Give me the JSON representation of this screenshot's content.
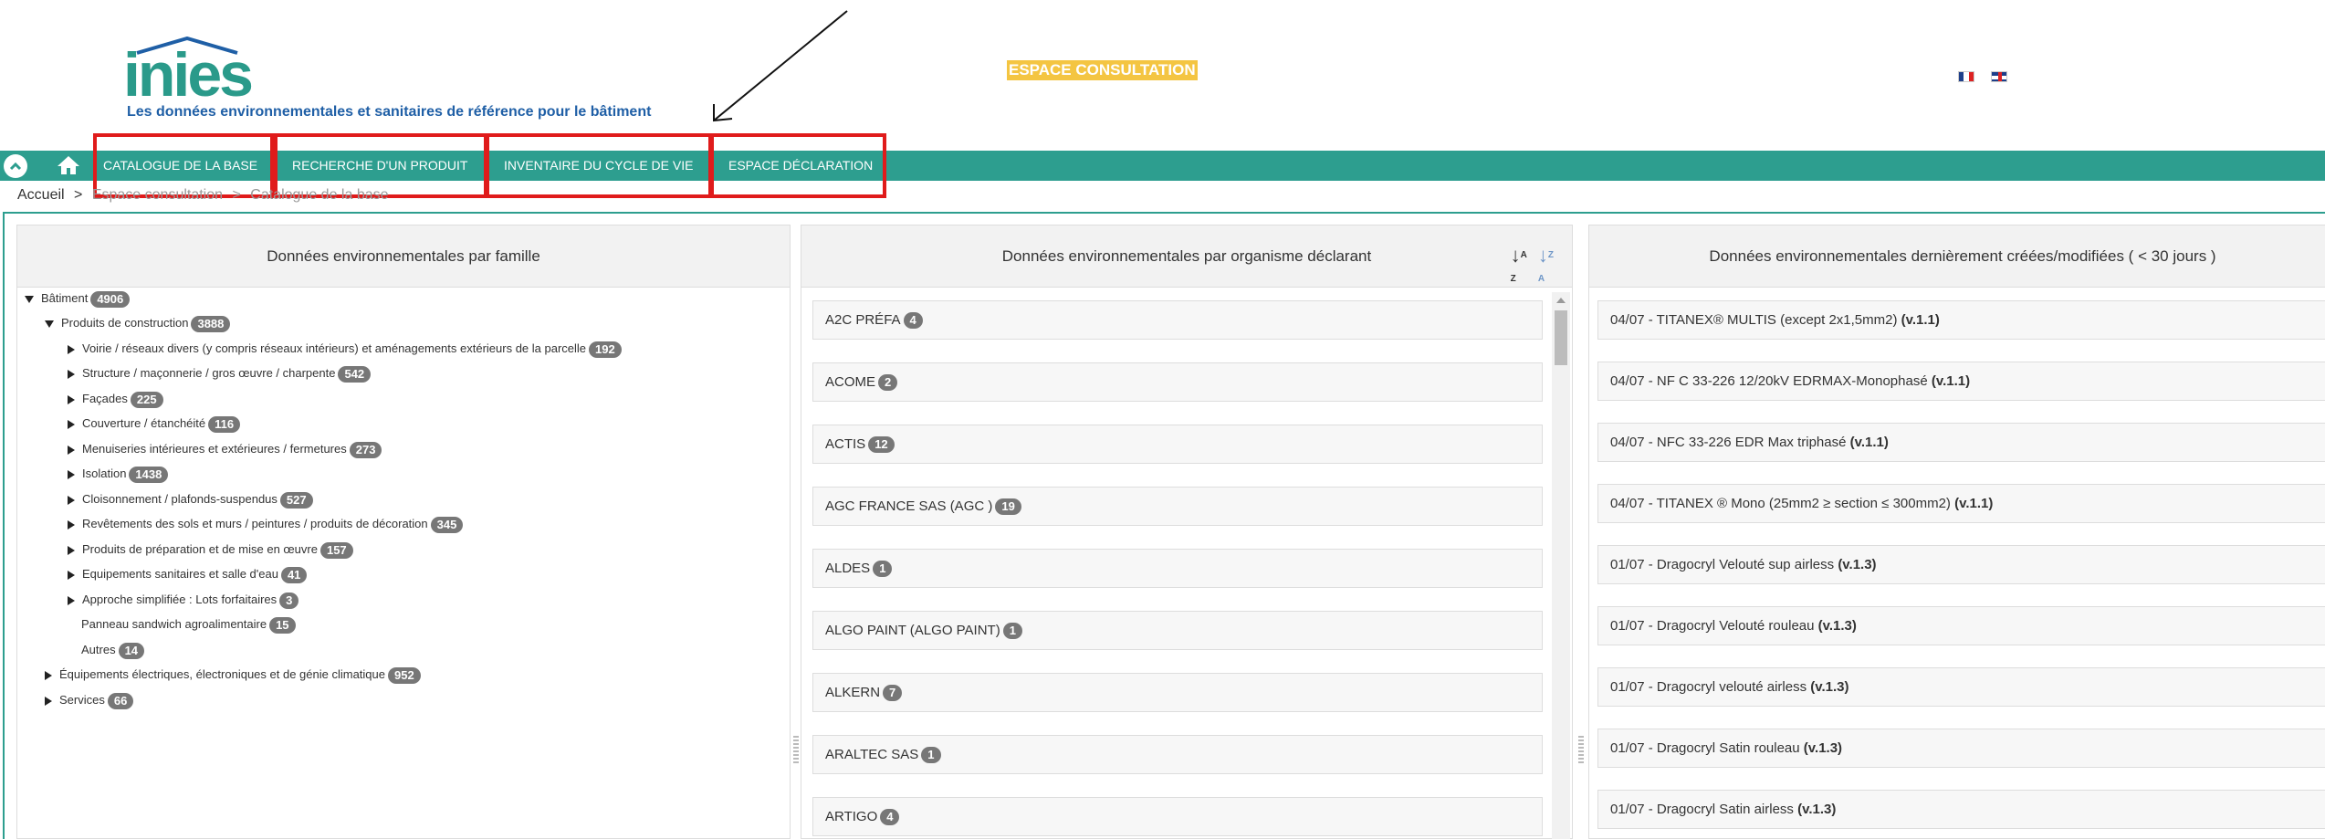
{
  "header": {
    "logo_text": "inies",
    "tagline": "Les données environnementales et sanitaires de référence pour le bâtiment",
    "espace_label": "ESPACE CONSULTATION",
    "languages": [
      "fr-flag-icon",
      "uk-flag-icon"
    ]
  },
  "nav": {
    "toggle_icon": "chevron-up-icon",
    "home_icon": "home-icon",
    "items": [
      {
        "label": "CATALOGUE DE LA BASE"
      },
      {
        "label": "RECHERCHE D'UN PRODUIT"
      },
      {
        "label": "INVENTAIRE DU CYCLE DE VIE"
      },
      {
        "label": "ESPACE DÉCLARATION"
      }
    ]
  },
  "breadcrumb": {
    "home": "Accueil",
    "sep": ">",
    "level1": "Espace consultation",
    "level2": "Catalogue de la base"
  },
  "panels": {
    "family": {
      "title": "Données environnementales par famille",
      "tree": [
        {
          "label": "Bâtiment",
          "count": "4906"
        },
        {
          "label": "Produits de construction",
          "count": "3888"
        },
        {
          "label": "Voirie / réseaux divers (y compris réseaux intérieurs) et aménagements extérieurs de la parcelle",
          "count": "192"
        },
        {
          "label": "Structure / maçonnerie / gros œuvre / charpente",
          "count": "542"
        },
        {
          "label": "Façades",
          "count": "225"
        },
        {
          "label": "Couverture / étanchéité",
          "count": "116"
        },
        {
          "label": "Menuiseries intérieures et extérieures / fermetures",
          "count": "273"
        },
        {
          "label": "Isolation",
          "count": "1438"
        },
        {
          "label": "Cloisonnement / plafonds-suspendus",
          "count": "527"
        },
        {
          "label": "Revêtements des sols et murs / peintures / produits de décoration",
          "count": "345"
        },
        {
          "label": "Produits de préparation et de mise en œuvre",
          "count": "157"
        },
        {
          "label": "Equipements sanitaires et salle d'eau",
          "count": "41"
        },
        {
          "label": "Approche simplifiée : Lots forfaitaires",
          "count": "3"
        },
        {
          "label": "Panneau sandwich agroalimentaire",
          "count": "15"
        },
        {
          "label": "Autres",
          "count": "14"
        },
        {
          "label": "Équipements électriques, électroniques et de génie climatique",
          "count": "952"
        },
        {
          "label": "Services",
          "count": "66"
        }
      ]
    },
    "organisms": {
      "title": "Données environnementales par organisme déclarant",
      "sort_az_icon": "sort-alpha-down-icon",
      "sort_za_icon": "sort-alpha-up-icon",
      "items": [
        {
          "name": "A2C PRÉFA",
          "count": "4"
        },
        {
          "name": "ACOME",
          "count": "2"
        },
        {
          "name": "ACTIS",
          "count": "12"
        },
        {
          "name": "AGC FRANCE SAS (AGC )",
          "count": "19"
        },
        {
          "name": "ALDES",
          "count": "1"
        },
        {
          "name": "ALGO PAINT (ALGO PAINT)",
          "count": "1"
        },
        {
          "name": "ALKERN",
          "count": "7"
        },
        {
          "name": "ARALTEC SAS",
          "count": "1"
        },
        {
          "name": "ARTIGO",
          "count": "4"
        }
      ]
    },
    "recent": {
      "title": "Données environnementales dernièrement créées/modifiées ( < 30 jours )",
      "items": [
        {
          "label": "04/07 - TITANEX® MULTIS (except 2x1,5mm2)",
          "version": "(v.1.1)"
        },
        {
          "label": "04/07 - NF C 33-226 12/20kV EDRMAX-Monophasé",
          "version": "(v.1.1)"
        },
        {
          "label": "04/07 - NFC 33-226 EDR Max triphasé",
          "version": "(v.1.1)"
        },
        {
          "label": "04/07 - TITANEX ® Mono (25mm2 ≥ section ≤ 300mm2)",
          "version": "(v.1.1)"
        },
        {
          "label": "01/07 - Dragocryl Velouté sup airless",
          "version": "(v.1.3)"
        },
        {
          "label": "01/07 - Dragocryl Velouté rouleau",
          "version": "(v.1.3)"
        },
        {
          "label": "01/07 - Dragocryl velouté airless",
          "version": "(v.1.3)"
        },
        {
          "label": "01/07 - Dragocryl Satin rouleau",
          "version": "(v.1.3)"
        },
        {
          "label": "01/07 - Dragocryl Satin airless",
          "version": "(v.1.3)"
        }
      ]
    }
  },
  "colors": {
    "nav_bg": "#2d9e8f",
    "highlight_box": "#e01b1b",
    "tagline": "#1f5fa6",
    "espace_bg": "#f4c542"
  }
}
